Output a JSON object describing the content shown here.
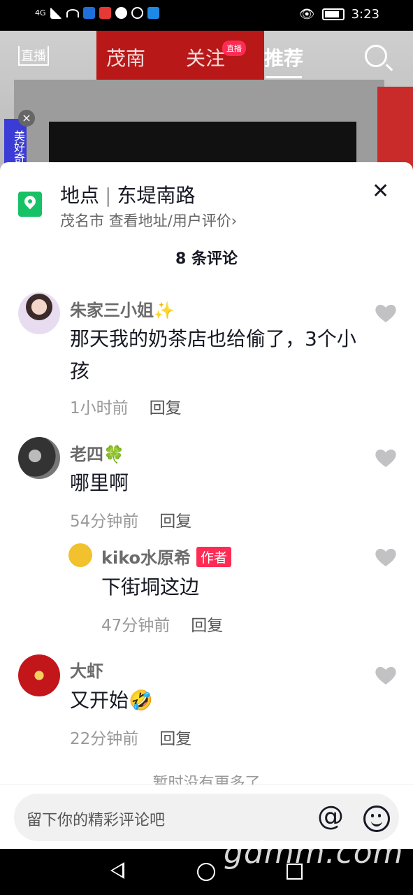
{
  "status_bar": {
    "network": "4G",
    "time": "3:23"
  },
  "top_nav": {
    "live_label": "直播",
    "tabs": [
      {
        "label": "茂南"
      },
      {
        "label": "关注",
        "badge": "直播"
      },
      {
        "label": "推荐"
      }
    ],
    "active_tab": "推荐"
  },
  "video_overlay": {
    "side_badge": "美好奇"
  },
  "sheet": {
    "location": {
      "prefix": "地点",
      "name": "东堤南路",
      "city": "茂名市",
      "link": "查看地址/用户评价›"
    },
    "comment_count": "8 条评论",
    "comments": [
      {
        "user": "朱家三小姐✨",
        "text": "那天我的奶茶店也给偷了，3个小孩",
        "time": "1小时前",
        "reply_label": "回复"
      },
      {
        "user": "老四🍀",
        "text": "哪里啊",
        "time": "54分钟前",
        "reply_label": "回复",
        "replies": [
          {
            "user": "kiko水原希",
            "tag": "作者",
            "text": "下街垌这边",
            "time": "47分钟前",
            "reply_label": "回复"
          }
        ]
      },
      {
        "user": "大虾",
        "text": "又开始🤣",
        "time": "22分钟前",
        "reply_label": "回复"
      }
    ],
    "no_more": "暂时没有更多了"
  },
  "input": {
    "placeholder": "留下你的精彩评论吧",
    "at_symbol": "@"
  },
  "watermark": "gdmm.com",
  "colors": {
    "accent": "#fe2c55",
    "location_green": "#16c265"
  }
}
